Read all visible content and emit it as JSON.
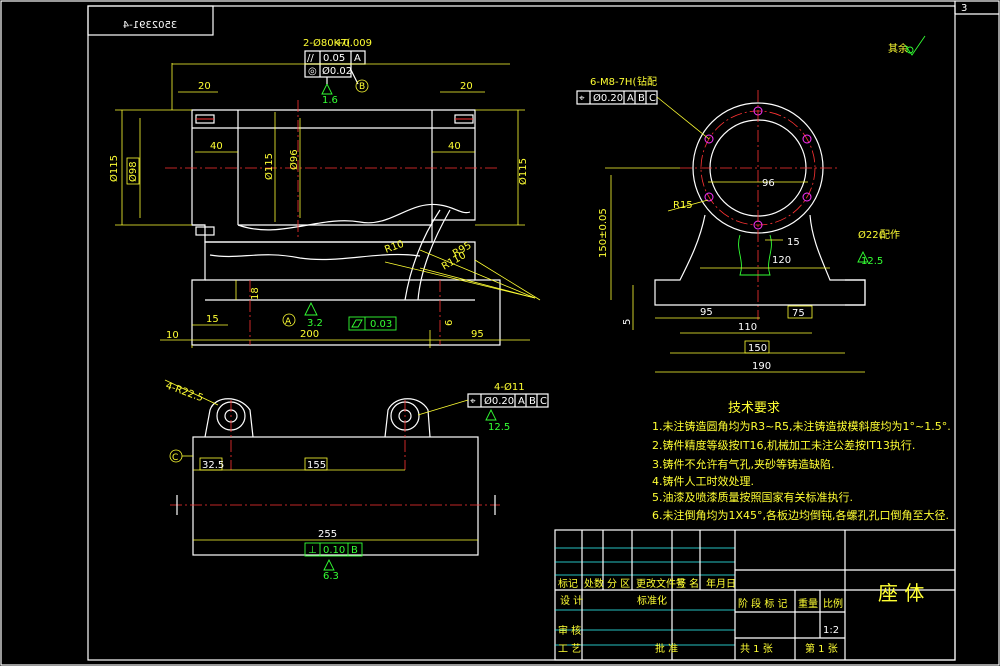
{
  "page_label": "3",
  "drawing_number": "3502391-4",
  "roughness_mark": "其余",
  "front_view": {
    "callout_hole": "2-Ø80K7(",
    "callout_hole_suffix": "+0.009",
    "fcf_parallel": {
      "symbol": "//",
      "value": "0.05",
      "datum": "A"
    },
    "fcf_position": {
      "symbol": "◎",
      "value": "Ø0.02",
      "datum": "B"
    },
    "datum_b": "B",
    "roughness_top": "1.6",
    "dim_20_left": "20",
    "dim_20_right": "20",
    "dim_40_left": "40",
    "dim_40_right": "40",
    "dia_115_left": "Ø115",
    "dia_98_boxed": "Ø98",
    "dia_115_mid": "Ø115",
    "dia_96_mid": "Ø96",
    "dia_115_right": "Ø115",
    "r10": "R10",
    "r95": "R95",
    "r110": "R110",
    "dim_18": "18",
    "dim_15": "15",
    "dim_6": "6",
    "dim_10": "10",
    "dim_200": "200",
    "dim_95": "95",
    "datum_a": "A",
    "roughness_base": "3.2",
    "flatness_value": "0.03"
  },
  "side_view": {
    "callout_thread": "6-M8-7H(",
    "callout_thread_suffix": "钻配",
    "fcf_position": {
      "value": "Ø0.20",
      "datums": [
        "A",
        "B",
        "C"
      ]
    },
    "dim_96": "96",
    "r15": "R15",
    "dim_15": "15",
    "dim_150_tol": "150±0.05",
    "dim_120": "120",
    "dia_22": "Ø22(",
    "dia_22_suffix": "配作",
    "roughness_right": "12.5",
    "dim_5": "5",
    "dim_95": "95",
    "dim_75": "75",
    "dim_110": "110",
    "dim_150": "150",
    "dim_190": "190"
  },
  "top_view": {
    "callout_radius": "4-R22.5",
    "callout_holes": "4-Ø11",
    "fcf_position": {
      "value": "Ø0.20",
      "datums": [
        "A",
        "B",
        "C"
      ]
    },
    "roughness_holes": "12.5",
    "datum_c": "C",
    "dim_32_5": "32.5",
    "dim_155": "155",
    "dim_255": "255",
    "fcf_perp": {
      "symbol": "⊥",
      "value": "0.10",
      "datum": "B"
    },
    "roughness_bottom": "6.3"
  },
  "tech_req": {
    "title": "技术要求",
    "items": [
      "1.未注铸造圆角均为R3~R5,未注铸造拔模斜度均为1°~1.5°.",
      "2.铸件精度等级按IT16,机械加工未注公差按IT13执行.",
      "3.铸件不允许有气孔,夹砂等铸造缺陷.",
      "4.铸件人工时效处理.",
      "5.油漆及喷漆质量按照国家有关标准执行.",
      "6.未注倒角均为1X45°,各板边均倒钝,各螺孔孔口倒角至大径."
    ]
  },
  "title_block": {
    "part_name": "座 体",
    "labels": {
      "mark": "标记",
      "count": "处数",
      "zone": "分 区",
      "change_doc": "更改文件号",
      "sign": "签 名",
      "date": "年月日",
      "design": "设 计",
      "standardize": "标准化",
      "stage_mark": "阶 段 标 记",
      "weight": "重量",
      "scale": "比例",
      "review": "审 核",
      "process": "工 艺",
      "approve": "批 准",
      "total_sheets": "共 1 张",
      "sheet_no": "第 1 张"
    },
    "scale_value": "1:2"
  }
}
